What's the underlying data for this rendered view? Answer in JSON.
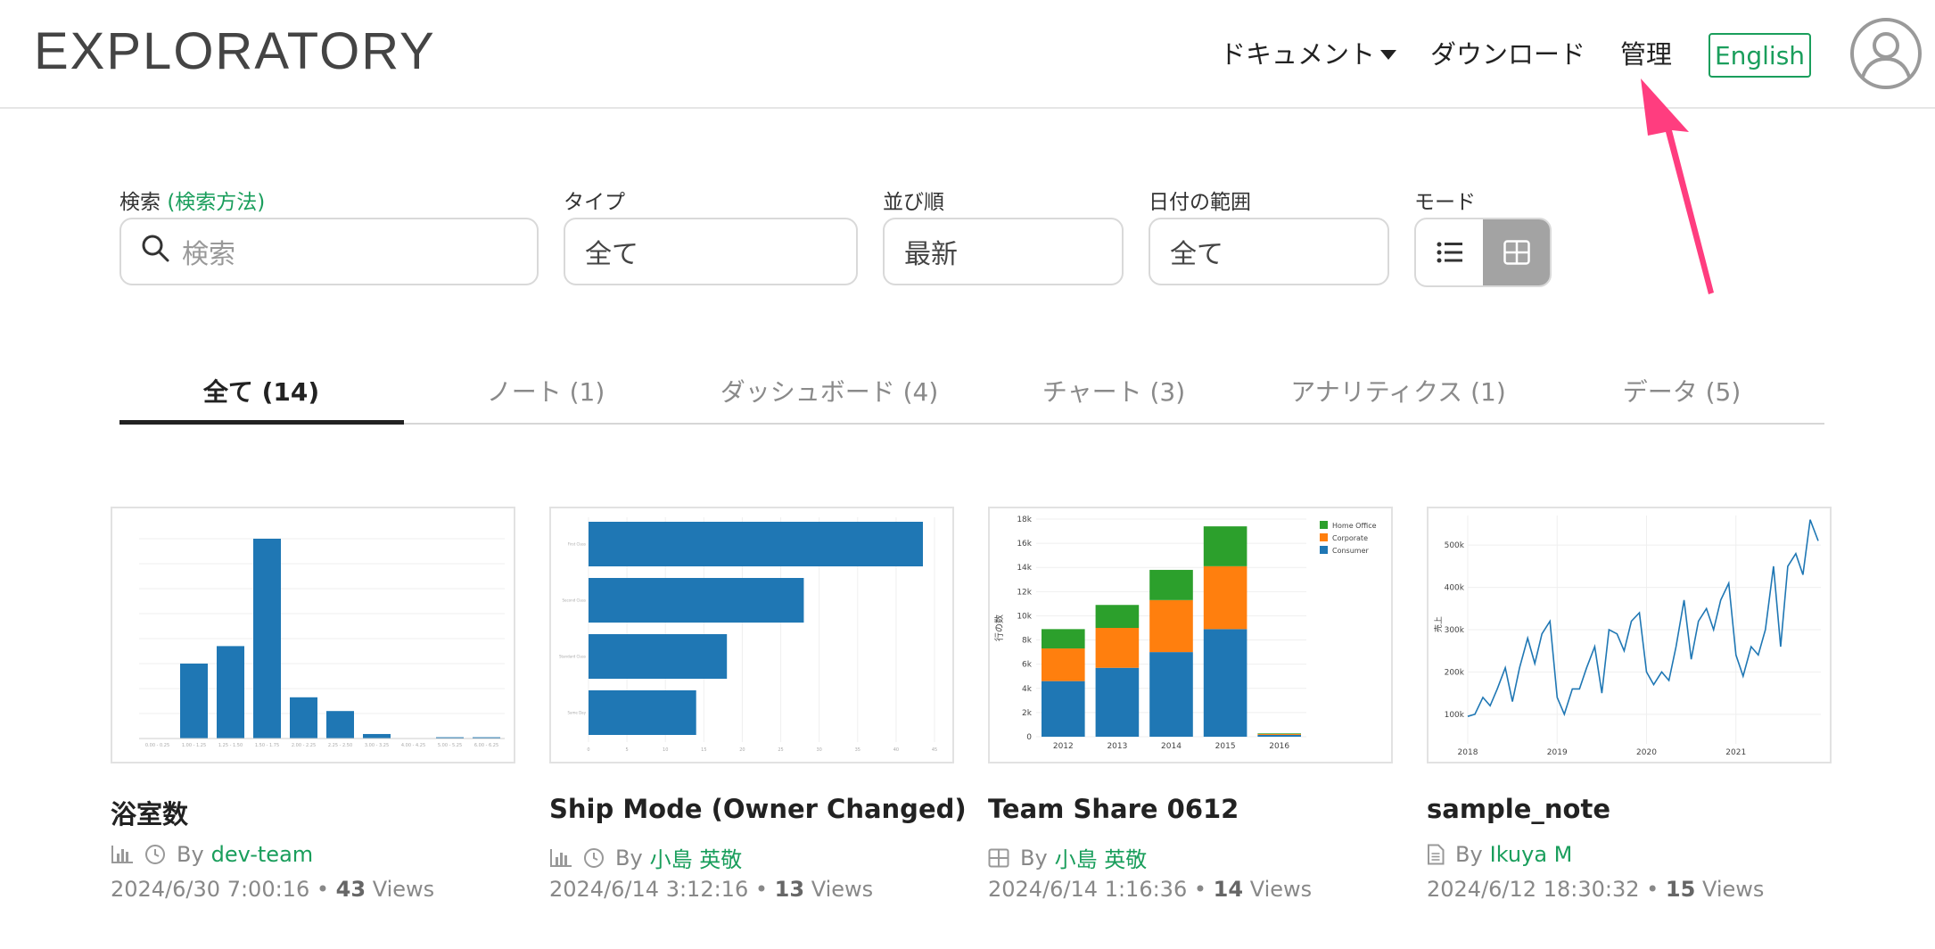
{
  "header": {
    "logo": "EXPLORATORY",
    "nav_docs": "ドキュメント",
    "nav_download": "ダウンロード",
    "nav_admin": "管理",
    "language_button": "English",
    "avatar_icon": "user-circle-icon"
  },
  "filters": {
    "search_label": "検索",
    "search_help": "(検索方法)",
    "search_placeholder": "検索",
    "type_label": "タイプ",
    "type_value": "全て",
    "order_label": "並び順",
    "order_value": "最新",
    "date_label": "日付の範囲",
    "date_value": "全て",
    "mode_label": "モード",
    "mode_selected": "grid"
  },
  "tabs": [
    {
      "label": "全て (14)",
      "active": true
    },
    {
      "label": "ノート (1)",
      "active": false
    },
    {
      "label": "ダッシュボード (4)",
      "active": false
    },
    {
      "label": "チャート (3)",
      "active": false
    },
    {
      "label": "アナリティクス (1)",
      "active": false
    },
    {
      "label": "データ (5)",
      "active": false
    }
  ],
  "cards": [
    {
      "title": "浴室数",
      "type_icon": "bar-chart-icon",
      "has_clock": true,
      "by": "By",
      "owner": "dev-team",
      "date": "2024/6/30 7:00:16",
      "bullet": "•",
      "views": "43",
      "views_label": "Views"
    },
    {
      "title": "Ship Mode (Owner Changed)",
      "type_icon": "bar-chart-icon",
      "has_clock": true,
      "by": "By",
      "owner": "小島 英敬",
      "date": "2024/6/14 3:12:16",
      "bullet": "•",
      "views": "13",
      "views_label": "Views"
    },
    {
      "title": "Team Share 0612",
      "type_icon": "dashboard-grid-icon",
      "has_clock": false,
      "by": "By",
      "owner": "小島 英敬",
      "date": "2024/6/14 1:16:36",
      "bullet": "•",
      "views": "14",
      "views_label": "Views"
    },
    {
      "title": "sample_note",
      "type_icon": "note-document-icon",
      "has_clock": false,
      "by": "By",
      "owner": "Ikuya M",
      "date": "2024/6/12 18:30:32",
      "bullet": "•",
      "views": "15",
      "views_label": "Views"
    }
  ],
  "chart_data": [
    {
      "type": "bar",
      "categories": [
        "0.00 - 0.25",
        "1.00 - 1.25",
        "1.25 - 1.50",
        "1.50 - 1.75",
        "2.00 - 2.25",
        "2.25 - 2.50",
        "3.00 - 3.25",
        "4.00 - 4.25",
        "5.00 - 5.25",
        "6.00 - 6.25"
      ],
      "values": [
        0,
        300,
        370,
        800,
        165,
        110,
        18,
        0,
        5,
        5
      ],
      "ylim": [
        0,
        850
      ]
    },
    {
      "type": "bar",
      "orientation": "horizontal",
      "categories": [
        "First Class",
        "Second Class",
        "Standard Class",
        "Same Day"
      ],
      "values": [
        48,
        28,
        18,
        14
      ],
      "xlim": [
        0,
        45
      ]
    },
    {
      "type": "bar",
      "stacked": true,
      "categories": [
        "2012",
        "2013",
        "2014",
        "2015",
        "2016"
      ],
      "ylabel": "行の数",
      "y_ticks": [
        "0",
        "2k",
        "4k",
        "6k",
        "8k",
        "10k",
        "12k",
        "14k",
        "16k",
        "18k"
      ],
      "ylim": [
        0,
        18000
      ],
      "legend_position": "top-right",
      "series": [
        {
          "name": "Consumer",
          "color": "#1f77b4",
          "values": [
            4600,
            5700,
            7000,
            8900,
            150
          ]
        },
        {
          "name": "Corporate",
          "color": "#ff7f0e",
          "values": [
            2700,
            3300,
            4300,
            5200,
            80
          ]
        },
        {
          "name": "Home Office",
          "color": "#2ca02c",
          "values": [
            1600,
            1900,
            2500,
            3300,
            50
          ]
        }
      ]
    },
    {
      "type": "line",
      "ylabel": "売上",
      "x_ticks": [
        "2018",
        "2019",
        "2020",
        "2021"
      ],
      "y_ticks": [
        "100k",
        "200k",
        "300k",
        "400k",
        "500k"
      ],
      "ylim": [
        30000,
        570000
      ],
      "x": [
        2018.0,
        2018.08,
        2018.17,
        2018.25,
        2018.33,
        2018.42,
        2018.5,
        2018.58,
        2018.67,
        2018.75,
        2018.83,
        2018.92,
        2019.0,
        2019.08,
        2019.17,
        2019.25,
        2019.33,
        2019.42,
        2019.5,
        2019.58,
        2019.67,
        2019.75,
        2019.83,
        2019.92,
        2020.0,
        2020.08,
        2020.17,
        2020.25,
        2020.33,
        2020.42,
        2020.5,
        2020.58,
        2020.67,
        2020.75,
        2020.83,
        2020.92,
        2021.0,
        2021.08,
        2021.17,
        2021.25,
        2021.33,
        2021.42,
        2021.5,
        2021.58,
        2021.67,
        2021.75,
        2021.83,
        2021.92
      ],
      "values": [
        95000,
        100000,
        140000,
        120000,
        160000,
        210000,
        130000,
        210000,
        280000,
        220000,
        290000,
        320000,
        140000,
        100000,
        160000,
        160000,
        210000,
        260000,
        150000,
        300000,
        290000,
        250000,
        320000,
        340000,
        200000,
        170000,
        200000,
        180000,
        260000,
        370000,
        230000,
        320000,
        350000,
        300000,
        370000,
        410000,
        240000,
        190000,
        260000,
        240000,
        300000,
        450000,
        260000,
        450000,
        480000,
        430000,
        560000,
        510000
      ]
    }
  ]
}
